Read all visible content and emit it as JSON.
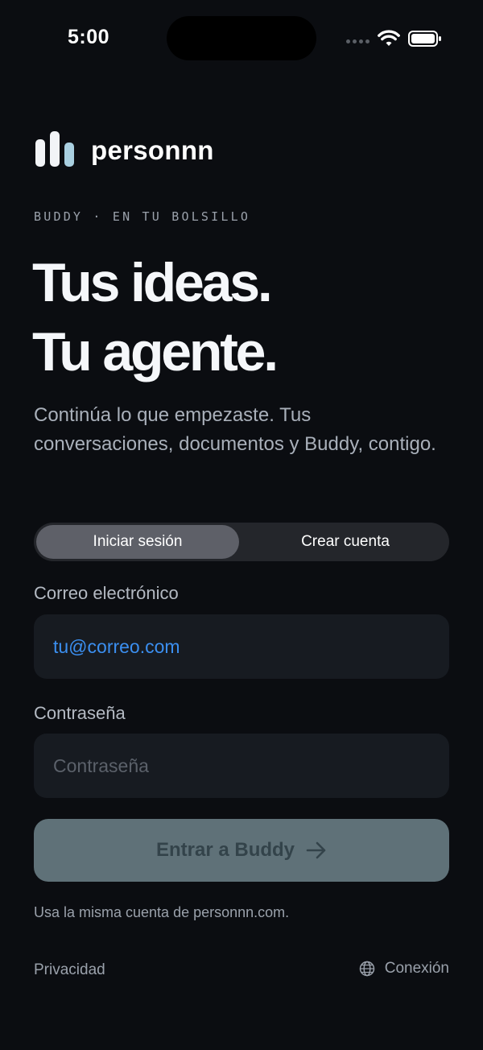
{
  "status_bar": {
    "time": "5:00"
  },
  "brand": {
    "name": "personnn",
    "mark_color_primary": "#f2f4f7",
    "mark_color_accent": "#a9cfe0"
  },
  "kicker": "BUDDY · EN TU BOLSILLO",
  "headline": {
    "line1": "Tus ideas.",
    "line2": "Tu agente."
  },
  "lead": "Continúa lo que empezaste. Tus conversaciones, documentos y Buddy, contigo.",
  "tabs": [
    {
      "label": "Iniciar sesión",
      "active": true
    },
    {
      "label": "Crear cuenta",
      "active": false
    }
  ],
  "email": {
    "label": "Correo electrónico",
    "placeholder": "tu@correo.com",
    "value": ""
  },
  "password": {
    "label": "Contraseña",
    "placeholder": "Contraseña",
    "value": ""
  },
  "submit": {
    "label": "Entrar a Buddy",
    "icon": "arrow-right-icon"
  },
  "hint": "Usa la misma cuenta de personnn.com.",
  "footer": {
    "privacy": "Privacidad",
    "connection": "Conexión",
    "connection_icon": "globe-icon"
  },
  "colors": {
    "background": "#0b0d11",
    "accent": "#3b8ff0",
    "button": "#5f7178"
  }
}
